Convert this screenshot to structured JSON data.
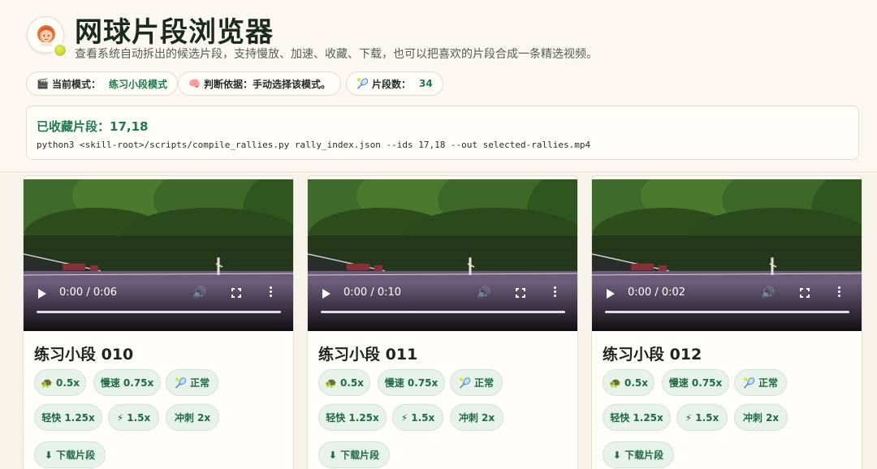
{
  "header": {
    "title": "网球片段浏览器",
    "subtitle": "查看系统自动拆出的候选片段，支持慢放、加速、收藏、下载，也可以把喜欢的片段合成一条精选视频。"
  },
  "pills": [
    {
      "icon": "🎬",
      "label": "当前模式：",
      "value": "练习小段模式"
    },
    {
      "icon": "🧠",
      "label": "判断依据：手动选择该模式。",
      "value": ""
    },
    {
      "icon": "🎾",
      "label": "片段数：",
      "value": "34"
    }
  ],
  "favorites": {
    "title": "已收藏片段：17,18",
    "command": "python3 <skill-root>/scripts/compile_rallies.py rally_index.json --ids 17,18 --out selected-rallies.mp4"
  },
  "speed_buttons": [
    {
      "icon": "🐢",
      "label": "0.5x"
    },
    {
      "icon": "",
      "label": "慢速 0.75x"
    },
    {
      "icon": "🎾",
      "label": "正常"
    },
    {
      "icon": "",
      "label": "轻快 1.25x"
    },
    {
      "icon": "⚡",
      "label": "1.5x"
    },
    {
      "icon": "",
      "label": "冲刺 2x"
    }
  ],
  "download_label": "⬇ 下载片段",
  "clips": [
    {
      "title": "练习小段 010",
      "time": "0:00 / 0:06",
      "progress": 0
    },
    {
      "title": "练习小段 011",
      "time": "0:00 / 0:10",
      "progress": 0
    },
    {
      "title": "练习小段 012",
      "time": "0:00 / 0:02",
      "progress": 0
    }
  ]
}
